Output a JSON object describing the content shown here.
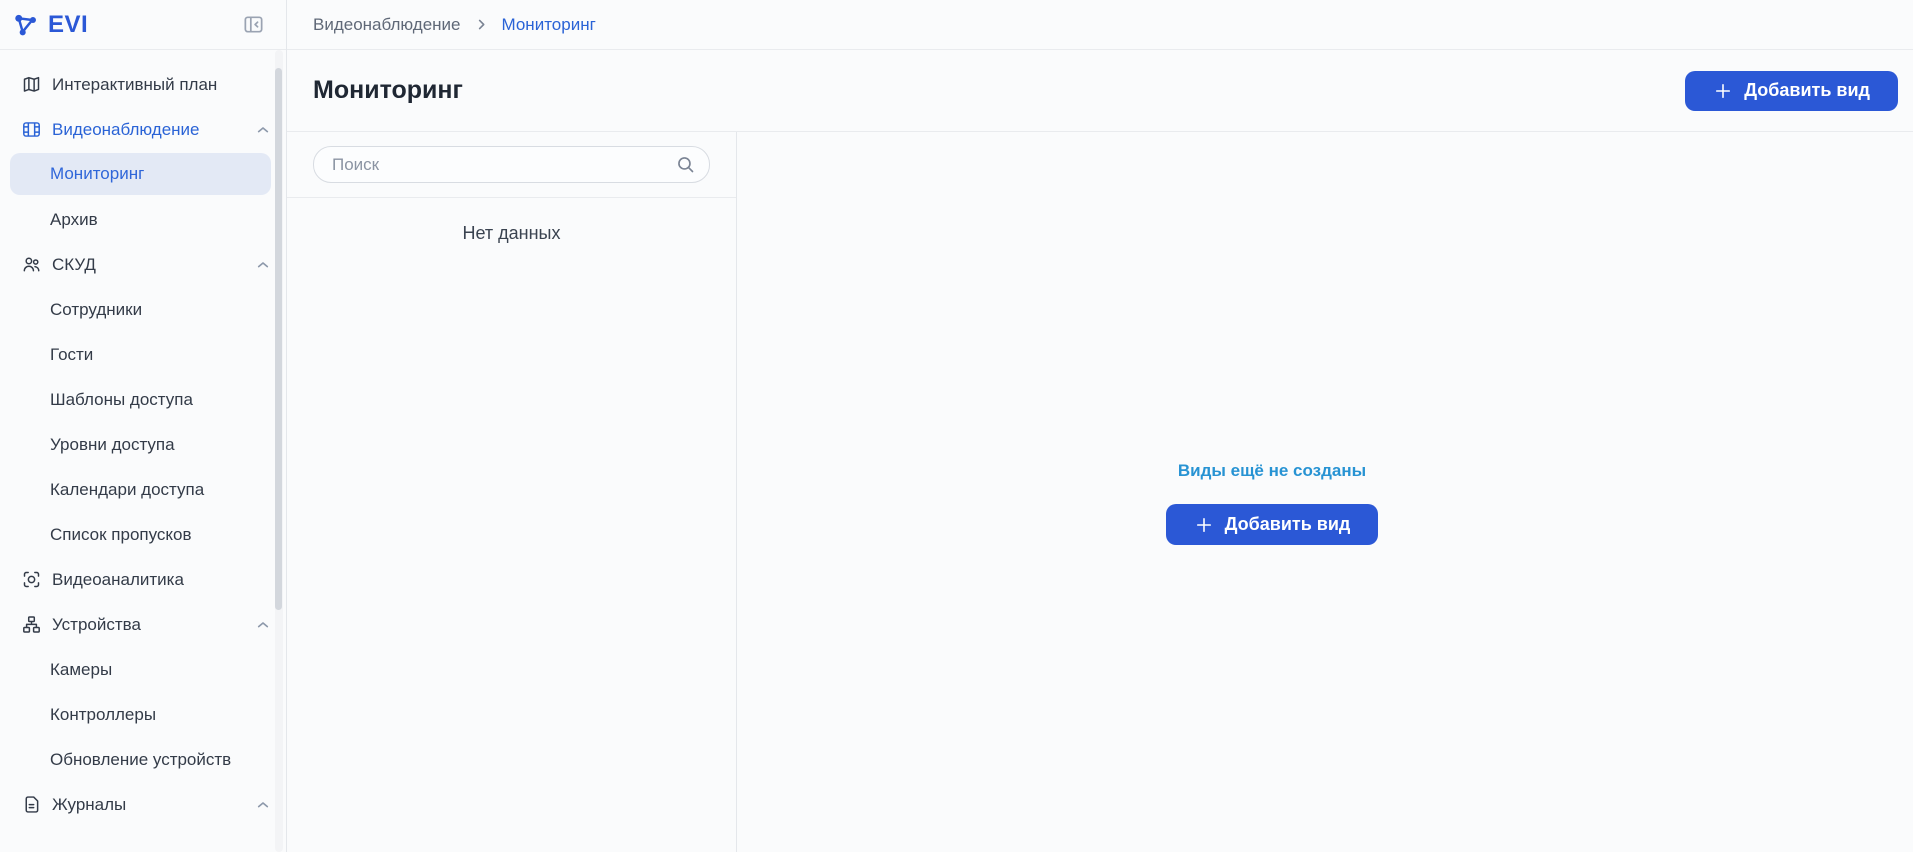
{
  "app": {
    "logo_text": "EVI"
  },
  "colors": {
    "accent": "#2b58d6",
    "link_blue": "#2a63d6",
    "info_blue": "#2793d3",
    "selected_item_bg": "#e3e9f5",
    "text_dark": "#1f2733",
    "text_gray": "#5f6877",
    "border": "#e9ebee"
  },
  "icons": {
    "logo": "molecule-icon",
    "sidebar_collapse": "panel-collapse-icon",
    "section_expanded": "chevron-up-icon",
    "breadcrumb_separator": "chevron-right-icon",
    "search": "magnifier-icon",
    "button_plus": "plus-icon"
  },
  "sidebar": {
    "items": [
      {
        "label": "Интерактивный план",
        "icon": "map-icon",
        "type": "root"
      },
      {
        "label": "Видеонаблюдение",
        "icon": "video-wall-icon",
        "type": "root",
        "expanded": true,
        "active": true
      },
      {
        "label": "Мониторинг",
        "type": "child",
        "selected": true
      },
      {
        "label": "Архив",
        "type": "child"
      },
      {
        "label": "СКУД",
        "icon": "users-icon",
        "type": "root",
        "expanded": true
      },
      {
        "label": "Сотрудники",
        "type": "child"
      },
      {
        "label": "Гости",
        "type": "child"
      },
      {
        "label": "Шаблоны доступа",
        "type": "child"
      },
      {
        "label": "Уровни доступа",
        "type": "child"
      },
      {
        "label": "Календари доступа",
        "type": "child"
      },
      {
        "label": "Список пропусков",
        "type": "child"
      },
      {
        "label": "Видеоаналитика",
        "icon": "scan-focus-icon",
        "type": "root"
      },
      {
        "label": "Устройства",
        "icon": "hierarchy-icon",
        "type": "root",
        "expanded": true
      },
      {
        "label": "Камеры",
        "type": "child"
      },
      {
        "label": "Контроллеры",
        "type": "child"
      },
      {
        "label": "Обновление устройств",
        "type": "child"
      },
      {
        "label": "Журналы",
        "icon": "document-icon",
        "type": "root",
        "expanded": true
      }
    ]
  },
  "breadcrumb": {
    "items": [
      "Видеонаблюдение",
      "Мониторинг"
    ]
  },
  "page": {
    "title": "Мониторинг",
    "add_view_label": "Добавить вид"
  },
  "search": {
    "placeholder": "Поиск"
  },
  "list": {
    "empty_text": "Нет данных"
  },
  "empty_state": {
    "message": "Виды ещё не созданы",
    "button_label": "Добавить вид"
  }
}
